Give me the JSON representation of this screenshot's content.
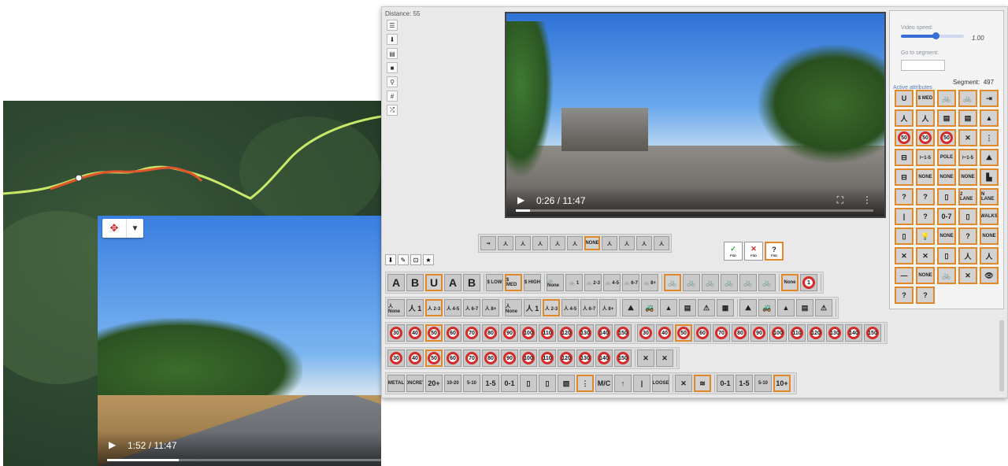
{
  "map": {
    "route_colors": {
      "route": "#c8e86a",
      "selected": "#e0552a"
    }
  },
  "map_video": {
    "locate_icon": "locate-icon",
    "dropdown_icon": "chevron-down-icon",
    "time": "1:52 / 11:47",
    "progress": 0.16
  },
  "app": {
    "distance": "Distance: 55",
    "tools": [
      "list-icon",
      "download-icon",
      "layers-icon",
      "video-icon",
      "pin-icon",
      "pin-alt-icon",
      "shuffle-icon"
    ],
    "tool_glyphs": [
      "☰",
      "⬇",
      "▤",
      "■",
      "⚲",
      "#",
      "⤮"
    ],
    "main_video": {
      "time": "0:26 / 11:47",
      "progress": 0.04
    },
    "side": {
      "speed_label": "Video speed:",
      "speed_value": "1.00",
      "goto_label": "Go to segment:",
      "segment_label": "Segment:",
      "segment_value": "497",
      "active_label": "Active attributes",
      "items": [
        "U",
        "$ MED",
        "🚲",
        "🚲",
        "⇥",
        "人",
        "人",
        "▤",
        "▤",
        "▲",
        "50",
        "50",
        "50",
        "✕",
        "⋮",
        "⊟",
        "⊢1-5",
        "POLE",
        "⊢1-5",
        "⛰",
        "⊟",
        "NONE",
        "NONE",
        "NONE",
        "▙",
        "?",
        "?",
        "▯",
        "2 LANE",
        "N LANE",
        "|",
        "?",
        "0-7",
        "▯",
        "WALKS",
        "▯",
        "💡",
        "NONE",
        "?",
        "NONE",
        "✕",
        "✕",
        "▯",
        "人",
        "人",
        "—",
        "NONE",
        "🚲",
        "✕",
        "👁",
        "?",
        "?"
      ],
      "selected": [
        0,
        1,
        2,
        3,
        4,
        5,
        6,
        7,
        8,
        9,
        10,
        11,
        12,
        13,
        14,
        15,
        16,
        17,
        18,
        19,
        20,
        21,
        22,
        23,
        24,
        25,
        26,
        27,
        28,
        29,
        30,
        31,
        32,
        33,
        34,
        35,
        36,
        37,
        38,
        39,
        40,
        41,
        42,
        43,
        44,
        45,
        46,
        47,
        48,
        49,
        50,
        51
      ]
    },
    "mid_row": [
      "⇝",
      "人",
      "人",
      "人",
      "人",
      "人",
      "NONE",
      "人",
      "人",
      "人",
      "人"
    ],
    "mid_buttons": [
      "✓",
      "✕",
      "?"
    ],
    "mid_button_sub": [
      "FSD",
      "FSD",
      "FSD"
    ],
    "tabs": [
      "⬇",
      "✎",
      "⊡",
      "★"
    ],
    "rows": [
      [
        [
          "A",
          "B",
          "U",
          "A",
          "B"
        ],
        [
          "$ LOW",
          "$ MED",
          "$ HIGH"
        ],
        [
          "🚲 None",
          "🚲 1",
          "🚲 2-3",
          "🚲 4-5",
          "🚲 6-7",
          "🚲 8+"
        ],
        [
          "🚲",
          "🚲",
          "🚲",
          "🚲",
          "🚲",
          "🚲"
        ],
        [
          "None",
          "1"
        ]
      ],
      [
        [
          "人 None",
          "人 1",
          "人 2-3",
          "人 4-5",
          "人 6-7",
          "人 8+"
        ],
        [
          "人 None",
          "人 1",
          "人 2-3",
          "人 4-5",
          "人 6-7",
          "人 8+"
        ],
        [
          "⛰",
          "🚜",
          "▲",
          "▤",
          "⚠",
          "▦"
        ],
        [
          "⛰",
          "🚜",
          "▲",
          "▤",
          "⚠"
        ]
      ],
      [
        [
          "30",
          "40",
          "50",
          "60",
          "70",
          "80",
          "90",
          "100",
          "110",
          "120",
          "130",
          "140",
          "150"
        ],
        [
          "30",
          "40",
          "50",
          "60",
          "70",
          "80",
          "90",
          "100",
          "110",
          "120",
          "130",
          "140",
          "150"
        ]
      ],
      [
        [
          "30",
          "40",
          "50",
          "60",
          "70",
          "80",
          "90",
          "100",
          "110",
          "120",
          "130",
          "140",
          "150"
        ],
        [
          "✕",
          "✕"
        ]
      ],
      [
        [
          "METAL",
          "CONCRETE",
          "20+",
          "10-20",
          "5-10",
          "1-5",
          "0-1",
          "▯",
          "▯",
          "▧",
          "⋮",
          "M/C",
          "↑",
          "|",
          "LOOSE"
        ],
        [
          "✕",
          "≋"
        ],
        [
          "0-1",
          "1-5",
          "5-10",
          "10+"
        ]
      ]
    ],
    "row_selected": {
      "0": [
        2,
        6,
        14,
        20
      ],
      "1": [
        2,
        8
      ],
      "2": [
        2,
        15
      ],
      "3": [
        2
      ],
      "4": [
        10,
        16,
        20
      ]
    }
  }
}
